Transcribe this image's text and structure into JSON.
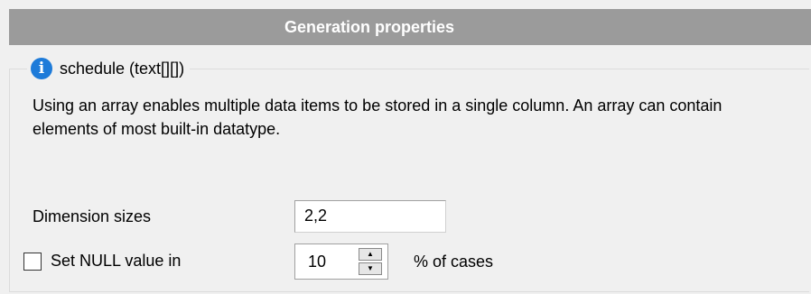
{
  "header": {
    "title": "Generation properties"
  },
  "group": {
    "title": "schedule (text[][])",
    "icon": "info-icon",
    "description": "Using an array enables multiple data items to be stored in a single column. An array can contain elements of most built-in datatype."
  },
  "dimension": {
    "label": "Dimension sizes",
    "value": "2,2"
  },
  "null_value": {
    "label": "Set NULL value in",
    "checked": false,
    "value": "10",
    "suffix": "% of cases"
  },
  "colors": {
    "header_bg": "#9b9b9b",
    "info_icon": "#1e7bd9",
    "background": "#f0f0f0"
  }
}
